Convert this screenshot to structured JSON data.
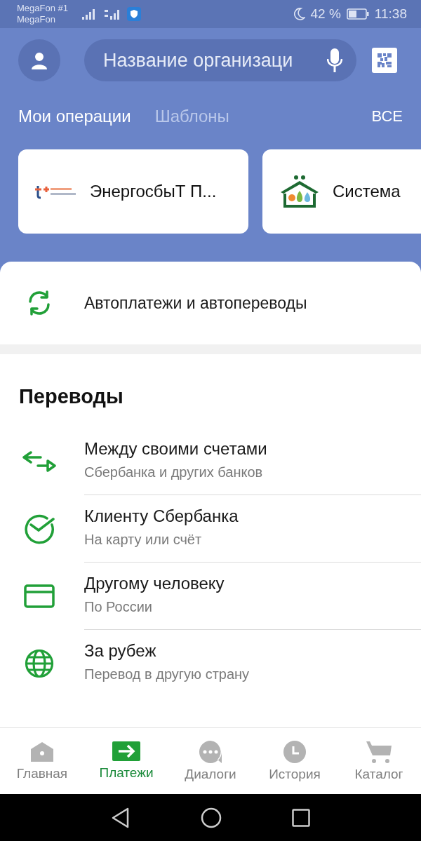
{
  "status_bar": {
    "carrier_1": "MegaFon #1",
    "carrier_2": "MegaFon",
    "battery": "42 %",
    "time": "11:38"
  },
  "search": {
    "placeholder": "Название организаци"
  },
  "tabs": [
    {
      "label": "Мои операции",
      "selected": true
    },
    {
      "label": "Шаблоны",
      "selected": false
    }
  ],
  "all_link": "ВСЕ",
  "templates": [
    {
      "kind": "energy",
      "name": "ЭнергосбыТ П..."
    },
    {
      "kind": "house",
      "name": "Система"
    }
  ],
  "autopay": {
    "label": "Автоплатежи и автопереводы"
  },
  "transfers": {
    "title": "Переводы",
    "items": [
      {
        "kind": "arrows",
        "title": "Между своими счетами",
        "subtitle": "Сбербанка и других банков"
      },
      {
        "kind": "sber",
        "title": "Клиенту Сбербанка",
        "subtitle": "На карту или счёт"
      },
      {
        "kind": "card",
        "title": "Другому человеку",
        "subtitle": "По России"
      },
      {
        "kind": "globe",
        "title": "За рубеж",
        "subtitle": "Перевод в другую страну"
      }
    ]
  },
  "nav": [
    {
      "kind": "home",
      "label": "Главная",
      "selected": false
    },
    {
      "kind": "payments",
      "label": "Платежи",
      "selected": true
    },
    {
      "kind": "dialogs",
      "label": "Диалоги",
      "selected": false
    },
    {
      "kind": "history",
      "label": "История",
      "selected": false
    },
    {
      "kind": "catalog",
      "label": "Каталог",
      "selected": false
    }
  ]
}
